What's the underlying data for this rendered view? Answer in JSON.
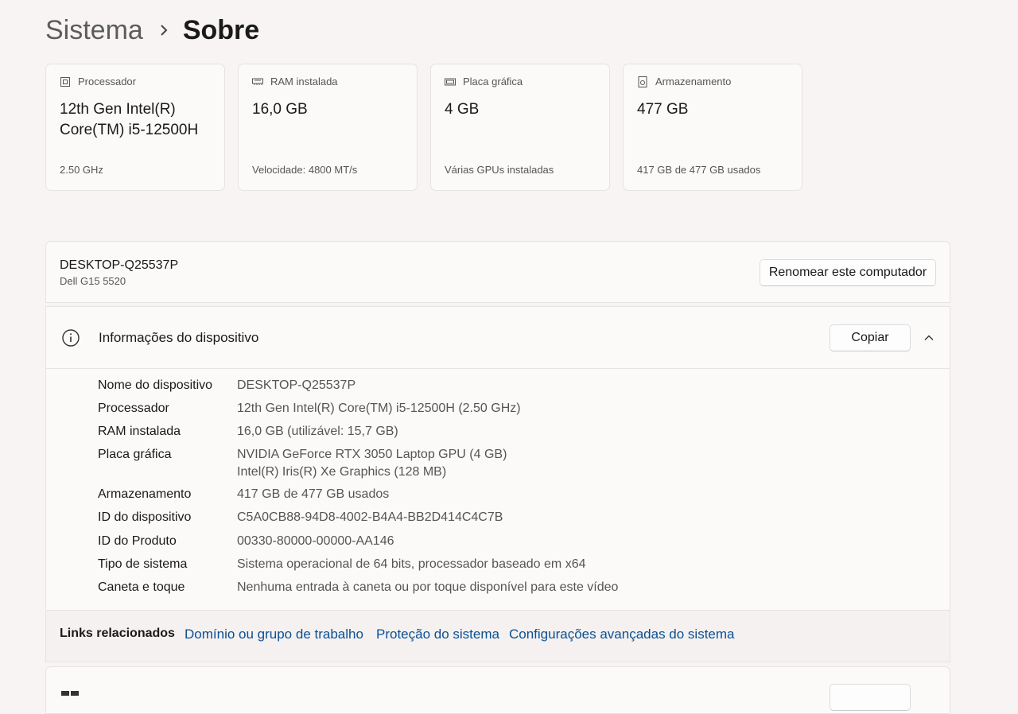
{
  "breadcrumb": {
    "parent": "Sistema",
    "current": "Sobre"
  },
  "cards": [
    {
      "icon": "processor-icon",
      "label": "Processador",
      "value": "12th Gen Intel(R) Core(TM) i5-12500H",
      "foot": "2.50 GHz"
    },
    {
      "icon": "ram-icon",
      "label": "RAM instalada",
      "value": "16,0 GB",
      "foot": "Velocidade: 4800 MT/s"
    },
    {
      "icon": "gpu-icon",
      "label": "Placa gráfica",
      "value": "4 GB",
      "foot": "Várias GPUs instaladas"
    },
    {
      "icon": "storage-icon",
      "label": "Armazenamento",
      "value": "477 GB",
      "foot": "417 GB de 477 GB usados"
    }
  ],
  "device": {
    "name": "DESKTOP-Q25537P",
    "model": "Dell G15 5520",
    "rename_label": "Renomear este computador"
  },
  "info": {
    "title": "Informações do dispositivo",
    "copy_label": "Copiar",
    "rows": [
      {
        "label": "Nome do dispositivo",
        "value": "DESKTOP-Q25537P"
      },
      {
        "label": "Processador",
        "value": "12th Gen Intel(R) Core(TM) i5-12500H (2.50 GHz)"
      },
      {
        "label": "RAM instalada",
        "value": "16,0 GB (utilizável: 15,7 GB)"
      },
      {
        "label": "Placa gráfica",
        "value": "NVIDIA GeForce RTX 3050 Laptop GPU (4 GB)",
        "value2": "Intel(R) Iris(R) Xe Graphics (128 MB)"
      },
      {
        "label": "Armazenamento",
        "value": "417 GB de 477 GB usados"
      },
      {
        "label": "ID do dispositivo",
        "value": "C5A0CB88-94D8-4002-B4A4-BB2D414C4C7B"
      },
      {
        "label": "ID do Produto",
        "value": "00330-80000-00000-AA146"
      },
      {
        "label": "Tipo de sistema",
        "value": "Sistema operacional de 64 bits, processador baseado em x64"
      },
      {
        "label": "Caneta e toque",
        "value": "Nenhuma entrada à caneta ou por toque disponível para este vídeo"
      }
    ]
  },
  "links": {
    "label": "Links relacionados",
    "items": [
      "Domínio ou grupo de trabalho",
      "Proteção do sistema",
      "Configurações avançadas do sistema"
    ]
  },
  "colors": {
    "link": "#0b4f94",
    "background": "#f7f4f3",
    "card": "#fbfaf9"
  }
}
